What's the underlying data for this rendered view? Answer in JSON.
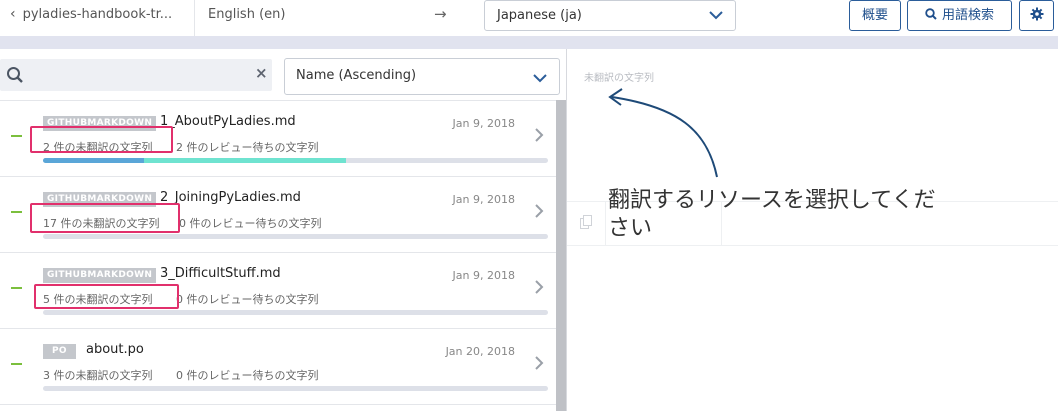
{
  "header": {
    "back_label": "pyladies-handbook-tr...",
    "source_language": "English (en)",
    "arrow": "→",
    "target_language": "Japanese (ja)",
    "overview_button": "概要",
    "glossary_button": "用語検索"
  },
  "search": {
    "placeholder": "",
    "sort_value": "Name (Ascending)"
  },
  "files": [
    {
      "format": "GITHUBMARKDOWN",
      "name": "1_AboutPyLadies.md",
      "date": "Jan 9, 2018",
      "untranslated": "2 件の未翻訳の文字列",
      "review": "2 件のレビュー待ちの文字列",
      "translated_fraction": 0.2,
      "review_fraction": 0.4,
      "highlighted": true
    },
    {
      "format": "GITHUBMARKDOWN",
      "name": "2_JoiningPyLadies.md",
      "date": "Jan 9, 2018",
      "untranslated": "17 件の未翻訳の文字列",
      "review": "0 件のレビュー待ちの文字列",
      "translated_fraction": 0,
      "review_fraction": 0,
      "highlighted": true
    },
    {
      "format": "GITHUBMARKDOWN",
      "name": "3_DifficultStuff.md",
      "date": "Jan 9, 2018",
      "untranslated": "5 件の未翻訳の文字列",
      "review": "0 件のレビュー待ちの文字列",
      "translated_fraction": 0,
      "review_fraction": 0,
      "highlighted": true
    },
    {
      "format": "PO",
      "name": "about.po",
      "date": "Jan 20, 2018",
      "untranslated": "3 件の未翻訳の文字列",
      "review": "0 件のレビュー待ちの文字列",
      "translated_fraction": 0,
      "review_fraction": 0,
      "highlighted": false
    }
  ],
  "editor": {
    "title_placeholder": "未翻訳の文字列",
    "instruction": "翻訳するリソースを選択してください"
  },
  "colors": {
    "accent": "#1f4f8c",
    "highlight": "#e1306c",
    "status_green": "#7bbf3d",
    "progress_translated": "#5aa6d8",
    "progress_review": "#6fe3d0"
  }
}
